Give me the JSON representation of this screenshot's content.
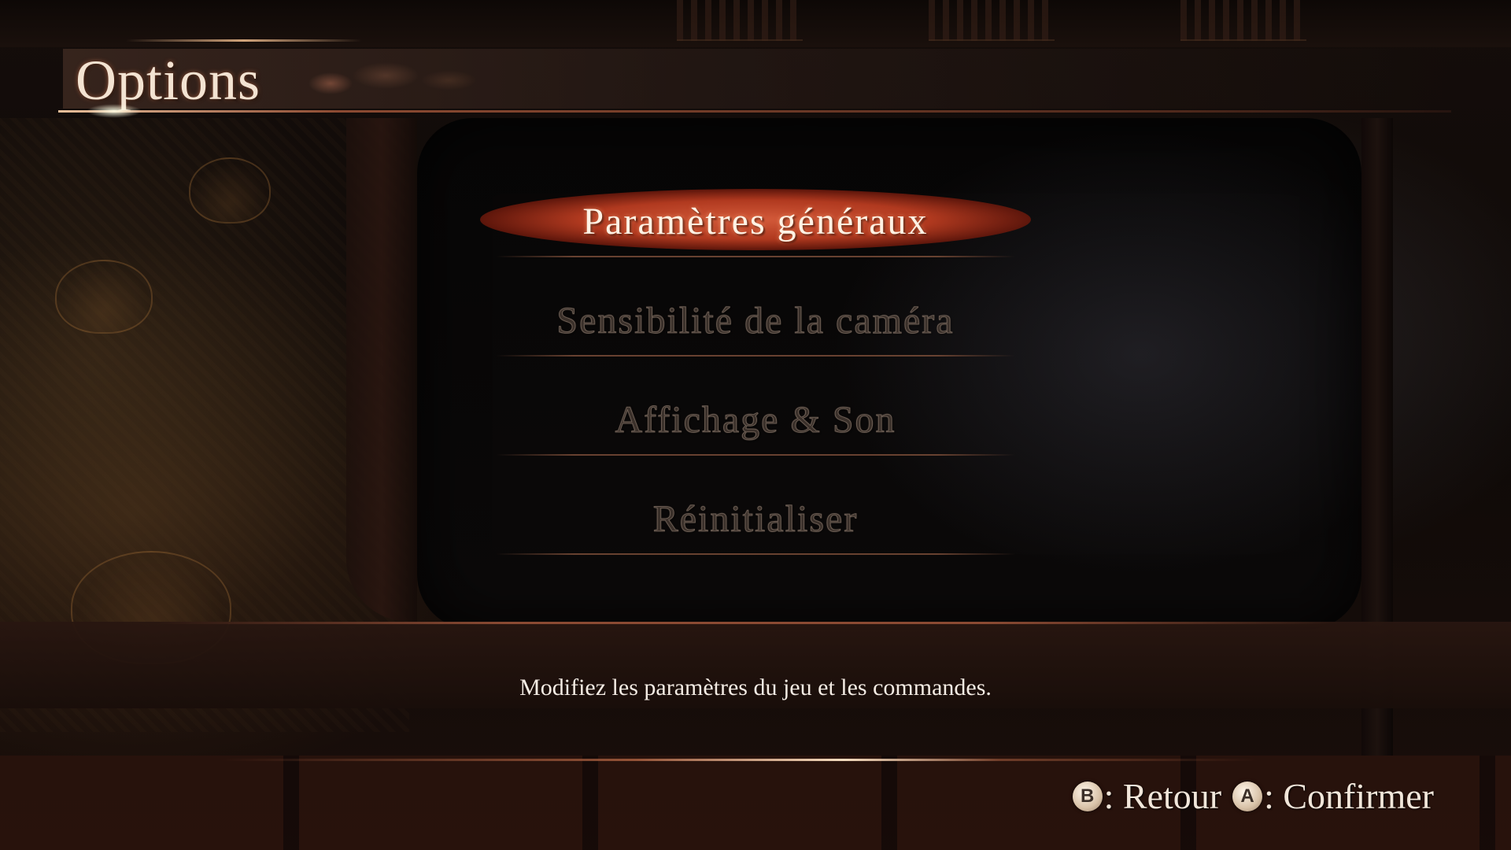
{
  "header": {
    "title": "Options"
  },
  "menu": {
    "items": [
      {
        "label": "Paramètres généraux",
        "selected": true
      },
      {
        "label": "Sensibilité de la caméra",
        "selected": false
      },
      {
        "label": "Affichage & Son",
        "selected": false
      },
      {
        "label": "Réinitialiser",
        "selected": false
      }
    ]
  },
  "description": {
    "text": "Modifiez les paramètres du jeu et les commandes."
  },
  "footer": {
    "back": {
      "button_icon": "B",
      "label": ": Retour"
    },
    "confirm": {
      "button_icon": "A",
      "label": ": Confirmer"
    }
  },
  "colors": {
    "accent": "#c8462a",
    "text_primary": "#f3e3d2",
    "text_inactive": "#3a302a"
  }
}
